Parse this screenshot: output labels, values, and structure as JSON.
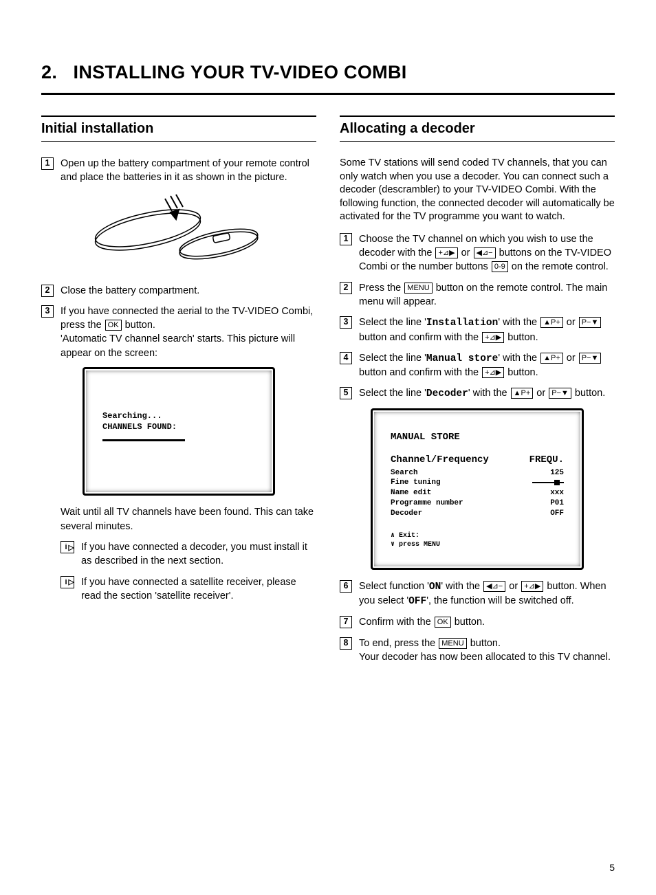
{
  "chapter": {
    "number": "2.",
    "title": "INSTALLING YOUR TV-VIDEO COMBI"
  },
  "pageNumber": "5",
  "left": {
    "heading": "Initial installation",
    "steps": {
      "s1": {
        "num": "1",
        "text": "Open up the battery compartment of your remote control and place the batteries in it as shown in the picture."
      },
      "s2": {
        "num": "2",
        "text": "Close the battery compartment."
      },
      "s3": {
        "num": "3",
        "part1": "If you have connected the aerial to the TV-VIDEO Combi, press the ",
        "key1": "OK",
        "part2": " button.",
        "line2": "'Automatic TV channel search' starts. This picture will appear on the screen:"
      }
    },
    "osd": {
      "line1": "Searching...",
      "line2": "CHANNELS FOUND:"
    },
    "afterOsd": "Wait until all TV channels have been found. This can take several minutes.",
    "notes": {
      "n1": "If you have connected a decoder, you must install it as described in the next section.",
      "n2": "If you have connected a satellite receiver, please read the section 'satellite receiver'."
    }
  },
  "right": {
    "heading": "Allocating a decoder",
    "intro": "Some TV stations will send coded TV channels, that you can only watch when you use a decoder. You can connect such a decoder (descrambler) to your TV-VIDEO Combi. With the following function, the connected decoder will automatically be activated for the TV programme you want to watch.",
    "steps": {
      "s1": {
        "num": "1",
        "p1": "Choose the TV channel on which you wish to use the decoder with the ",
        "k1": "+⊿▶",
        "mid1": " or ",
        "k2": "◀⊿−",
        "p2": " buttons on the TV-VIDEO Combi or the number buttons ",
        "k3": "0-9",
        "p3": " on the remote control."
      },
      "s2": {
        "num": "2",
        "p1": "Press the ",
        "k1": "MENU",
        "p2": " button on the remote control. The main menu will appear."
      },
      "s3": {
        "num": "3",
        "p1": "Select the line '",
        "term": "Installation",
        "p2": "' with the ",
        "k1": "▲P+",
        "mid1": " or ",
        "k2": "P−▼",
        "p3": " button and confirm with the ",
        "k3": "+⊿▶",
        "p4": " button."
      },
      "s4": {
        "num": "4",
        "p1": "Select the line '",
        "term": "Manual store",
        "p2": "' with the ",
        "k1": "▲P+",
        "mid1": " or ",
        "k2": "P−▼",
        "p3": " button and confirm with the ",
        "k3": "+⊿▶",
        "p4": " button."
      },
      "s5": {
        "num": "5",
        "p1": "Select the line '",
        "term": "Decoder",
        "p2": "' with the ",
        "k1": "▲P+",
        "mid1": " or ",
        "k2": "P−▼",
        "p3": " button."
      },
      "s6": {
        "num": "6",
        "p1": "Select function '",
        "term1": "ON",
        "p2": "' with the ",
        "k1": "◀⊿−",
        "mid1": " or ",
        "k2": "+⊿▶",
        "p3": " button. When you select '",
        "term2": "OFF",
        "p4": "', the function will be switched off."
      },
      "s7": {
        "num": "7",
        "p1": "Confirm with the ",
        "k1": "OK",
        "p2": " button."
      },
      "s8": {
        "num": "8",
        "p1": "To end, press the ",
        "k1": "MENU",
        "p2": " button.",
        "line2": "Your decoder has now been allocated to this TV channel."
      }
    },
    "osd": {
      "title": "MANUAL STORE",
      "row1": {
        "l": "Channel/Frequency",
        "r": "FREQU."
      },
      "row2": {
        "l": "Search",
        "r": "125"
      },
      "row3": {
        "l": "Fine tuning"
      },
      "row4": {
        "l": "Name edit",
        "r": "xxx"
      },
      "row5": {
        "l": "Programme number",
        "r": "P01"
      },
      "row6": {
        "l": "Decoder",
        "r": "OFF"
      },
      "foot1": "∧ Exit:",
      "foot2": "∨ press MENU"
    }
  }
}
